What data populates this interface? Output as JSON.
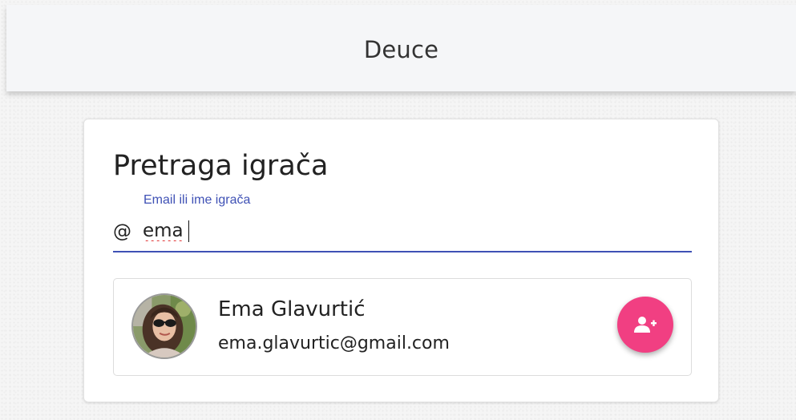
{
  "app": {
    "title": "Deuce"
  },
  "search": {
    "title": "Pretraga igrača",
    "label": "Email ili ime igrača",
    "prefix_icon": "at-sign-icon",
    "prefix_symbol": "@",
    "value": "ema"
  },
  "results": [
    {
      "name": "Ema Glavurtić",
      "email": "ema.glavurtic@gmail.com",
      "avatar": "user-photo",
      "action_icon": "person-add-icon"
    }
  ],
  "colors": {
    "accent": "#3f51b5",
    "fab": "#f13f82",
    "app_bar": "#f5f6f8"
  }
}
